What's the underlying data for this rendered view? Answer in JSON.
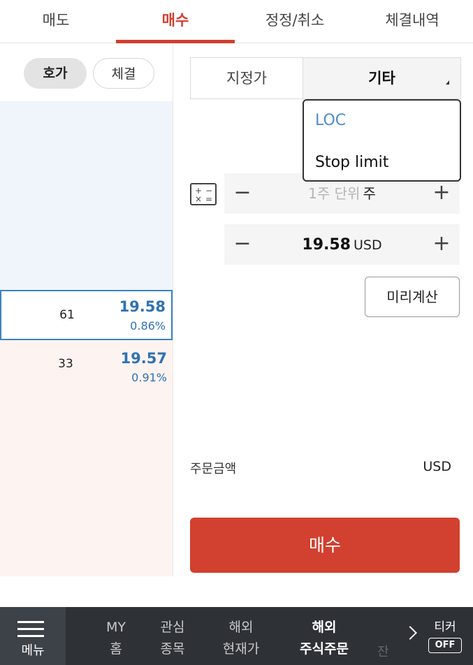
{
  "tabs": [
    {
      "label": "매도"
    },
    {
      "label": "매수"
    },
    {
      "label": "정정/취소"
    },
    {
      "label": "체결내역"
    }
  ],
  "orderbook": {
    "view_toggle": {
      "hoga": "호가",
      "chegyeol": "체결"
    },
    "rows": [
      {
        "qty": "61",
        "price": "19.58",
        "rate": "0.86%"
      },
      {
        "qty": "33",
        "price": "19.57",
        "rate": "0.91%"
      }
    ]
  },
  "order_form": {
    "order_type": {
      "limit": "지정가",
      "other": "기타"
    },
    "dropdown_options": [
      "LOC",
      "Stop limit"
    ],
    "quantity": {
      "placeholder": "1주 단위",
      "unit": "주",
      "minus": "−",
      "plus": "+"
    },
    "price": {
      "value": "19.58",
      "unit": "USD",
      "minus": "−",
      "plus": "+"
    },
    "calculator_icon": {
      "s1": "+",
      "s2": "−",
      "s3": "×",
      "s4": "="
    },
    "precalc_label": "미리계산",
    "amount_label": "주문금액",
    "amount_unit": "USD",
    "submit_label": "매수"
  },
  "bottom_nav": {
    "menu_label": "메뉴",
    "items": [
      {
        "line1": "MY",
        "line2": "홈"
      },
      {
        "line1": "관심",
        "line2": "종목"
      },
      {
        "line1": "해외",
        "line2": "현재가"
      },
      {
        "line1": "해외",
        "line2": "주식주문"
      }
    ],
    "faded_item": "잔",
    "ticker_label": "티커",
    "ticker_state": "OFF"
  },
  "colors": {
    "accent": "#d2402f",
    "blue": "#2f72b3",
    "nav_bg": "#2e3237"
  }
}
